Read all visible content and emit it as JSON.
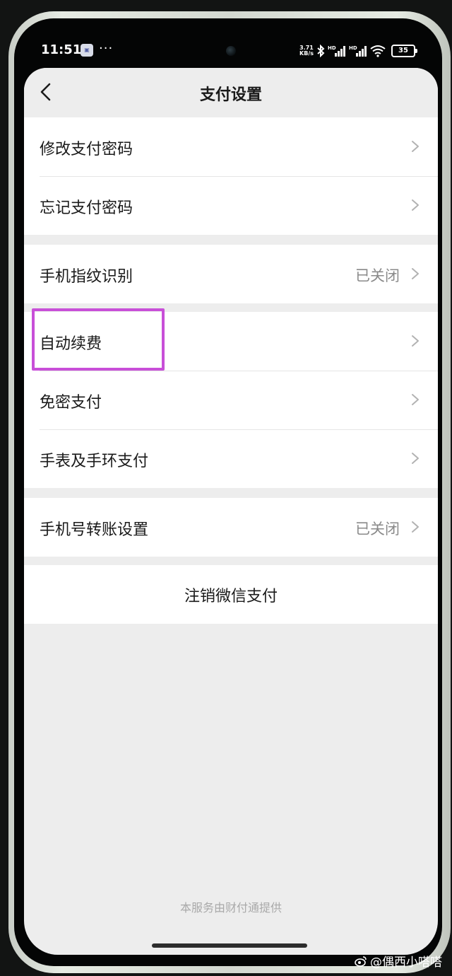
{
  "status_bar": {
    "time": "11:51",
    "net_speed_value": "3.71",
    "net_speed_unit": "KB/s",
    "battery": "35",
    "icons": [
      "notification-app-icon",
      "more-dots-icon",
      "bluetooth-icon",
      "hd-signal-icon",
      "hd-signal-icon",
      "wifi-icon",
      "battery-icon"
    ]
  },
  "header": {
    "title": "支付设置",
    "back_icon": "chevron-left-icon"
  },
  "groups": [
    {
      "rows": [
        {
          "label": "修改支付密码",
          "value": ""
        },
        {
          "label": "忘记支付密码",
          "value": ""
        }
      ]
    },
    {
      "rows": [
        {
          "label": "手机指纹识别",
          "value": "已关闭"
        }
      ]
    },
    {
      "rows": [
        {
          "label": "自动续费",
          "value": ""
        },
        {
          "label": "免密支付",
          "value": ""
        },
        {
          "label": "手表及手环支付",
          "value": ""
        }
      ]
    },
    {
      "rows": [
        {
          "label": "手机号转账设置",
          "value": "已关闭"
        }
      ]
    }
  ],
  "logout": {
    "label": "注销微信支付"
  },
  "footer": {
    "note": "本服务由财付通提供"
  },
  "watermark": {
    "text": "@偶西小嗒嗒"
  },
  "colors": {
    "highlight": "#c84fd8",
    "screen_bg": "#ededed",
    "card_bg": "#ffffff",
    "secondary_text": "#8a8a8a"
  }
}
